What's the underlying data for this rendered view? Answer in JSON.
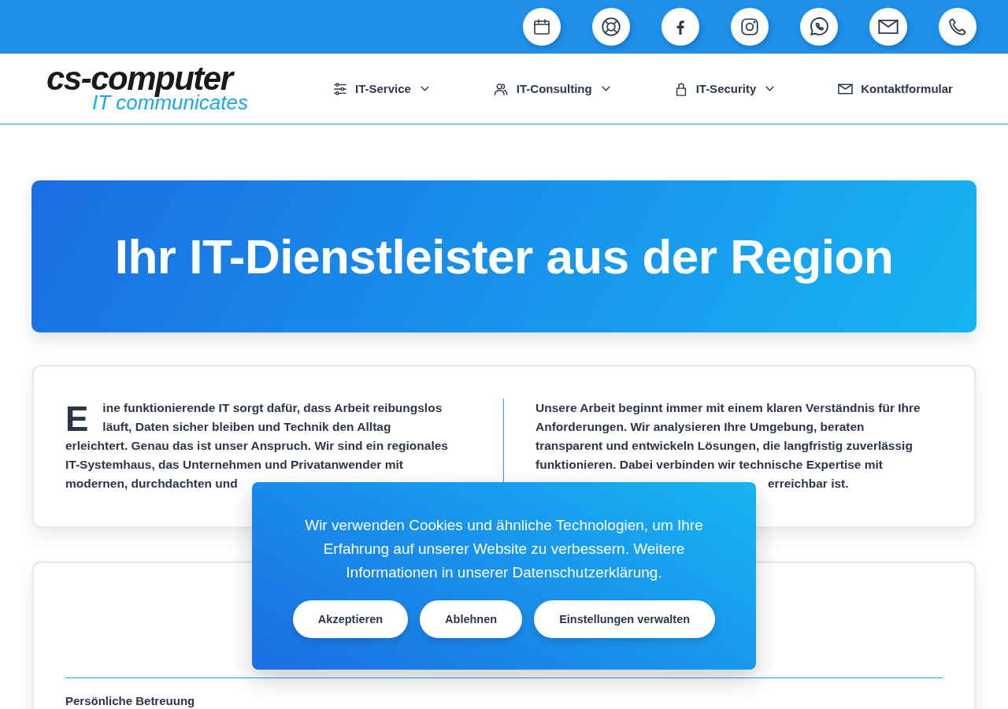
{
  "logo": {
    "name": "cs-computer",
    "tagline": "IT communicates"
  },
  "nav": [
    {
      "label": "IT-Service",
      "dropdown": true
    },
    {
      "label": "IT-Consulting",
      "dropdown": true
    },
    {
      "label": "IT-Security",
      "dropdown": true
    },
    {
      "label": "Kontaktformular",
      "dropdown": false
    }
  ],
  "hero": {
    "title": "Ihr IT-Dienstleister aus der Region"
  },
  "intro": {
    "drop_cap": "E",
    "left": "ine funktionierende IT sorgt dafür, dass Arbeit reibungslos läuft, Daten sicher bleiben und Technik den Alltag erleichtert. Genau das ist unser Anspruch. Wir sind ein regionales IT-Systemhaus, das Unternehmen und Privatanwender mit modernen, durchdachten und",
    "right": "Unsere Arbeit beginnt immer mit einem klaren Verständnis für Ihre Anforderungen. Wir analysieren Ihre Umgebung, beraten transparent und entwickeln Lösungen, die langfristig zuverlässig funktionieren. Dabei verbinden wir technische Expertise mit",
    "right_tail": "erreichbar ist."
  },
  "section": {
    "heading": "Persönliche Betreuung"
  },
  "cookie_banner": {
    "text": "Wir verwenden Cookies und ähnliche Technologien, um Ihre Erfahrung auf unserer Website zu verbessern. Weitere Informationen in unserer Datenschutzerklärung.",
    "buttons": [
      "Akzeptieren",
      "Ablehnen",
      "Einstellungen verwalten"
    ]
  }
}
